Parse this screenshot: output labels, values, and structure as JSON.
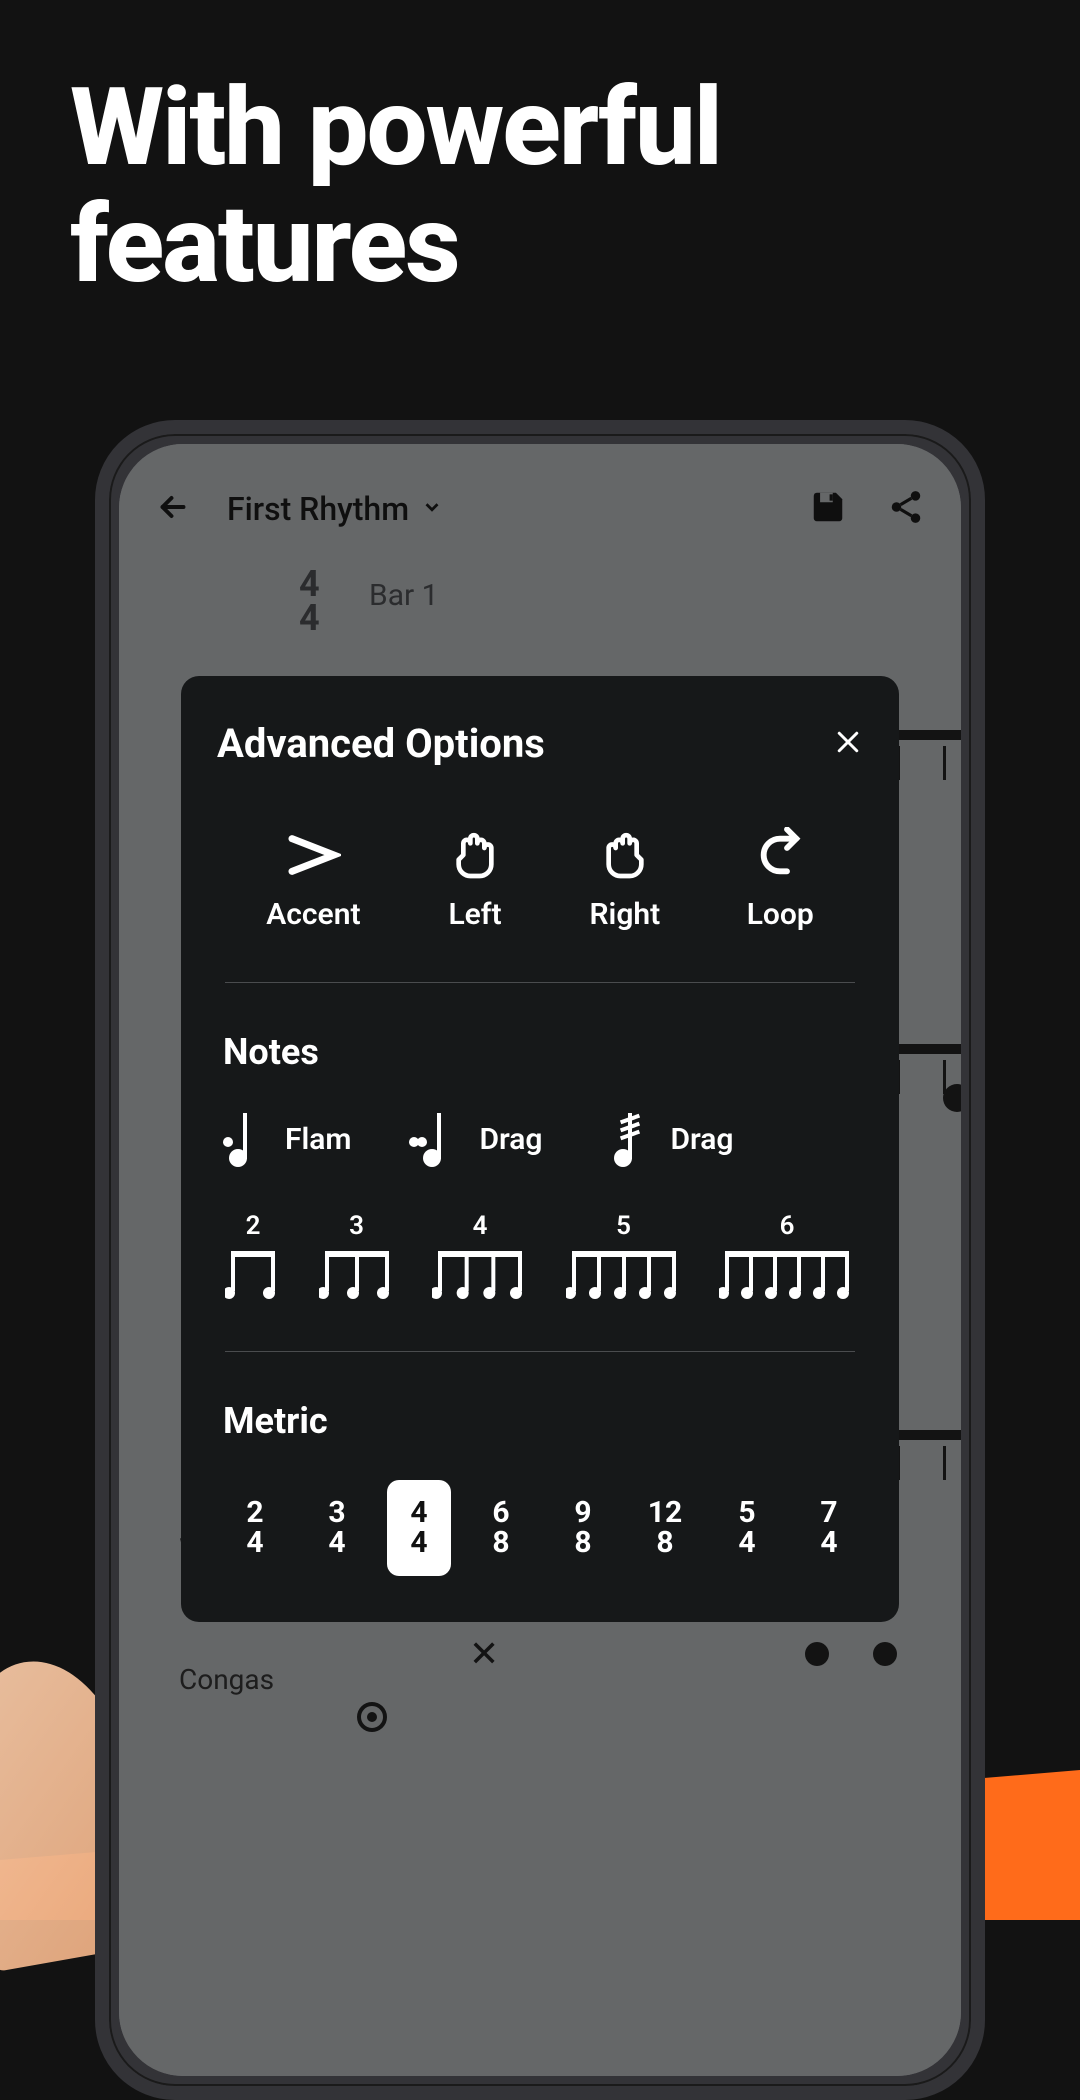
{
  "hero": {
    "line1": "With powerful",
    "line2": "features"
  },
  "app": {
    "title": "First Rhythm",
    "time_sig_top": "4",
    "time_sig_bottom": "4",
    "bar_label": "Bar 1",
    "track_label": "Congas"
  },
  "modal": {
    "title": "Advanced Options",
    "actions": [
      {
        "id": "accent",
        "label": "Accent"
      },
      {
        "id": "left",
        "label": "Left"
      },
      {
        "id": "right",
        "label": "Right"
      },
      {
        "id": "loop",
        "label": "Loop"
      }
    ],
    "notes_title": "Notes",
    "note_types": [
      {
        "id": "flam",
        "label": "Flam"
      },
      {
        "id": "drag1",
        "label": "Drag"
      },
      {
        "id": "drag2",
        "label": "Drag"
      }
    ],
    "subdivisions": [
      2,
      3,
      4,
      5,
      6
    ],
    "metric_title": "Metric",
    "metrics": [
      {
        "top": "2",
        "bottom": "4",
        "selected": false
      },
      {
        "top": "3",
        "bottom": "4",
        "selected": false
      },
      {
        "top": "4",
        "bottom": "4",
        "selected": true
      },
      {
        "top": "6",
        "bottom": "8",
        "selected": false
      },
      {
        "top": "9",
        "bottom": "8",
        "selected": false
      },
      {
        "top": "12",
        "bottom": "8",
        "selected": false
      },
      {
        "top": "5",
        "bottom": "4",
        "selected": false
      },
      {
        "top": "7",
        "bottom": "4",
        "selected": false
      }
    ]
  }
}
